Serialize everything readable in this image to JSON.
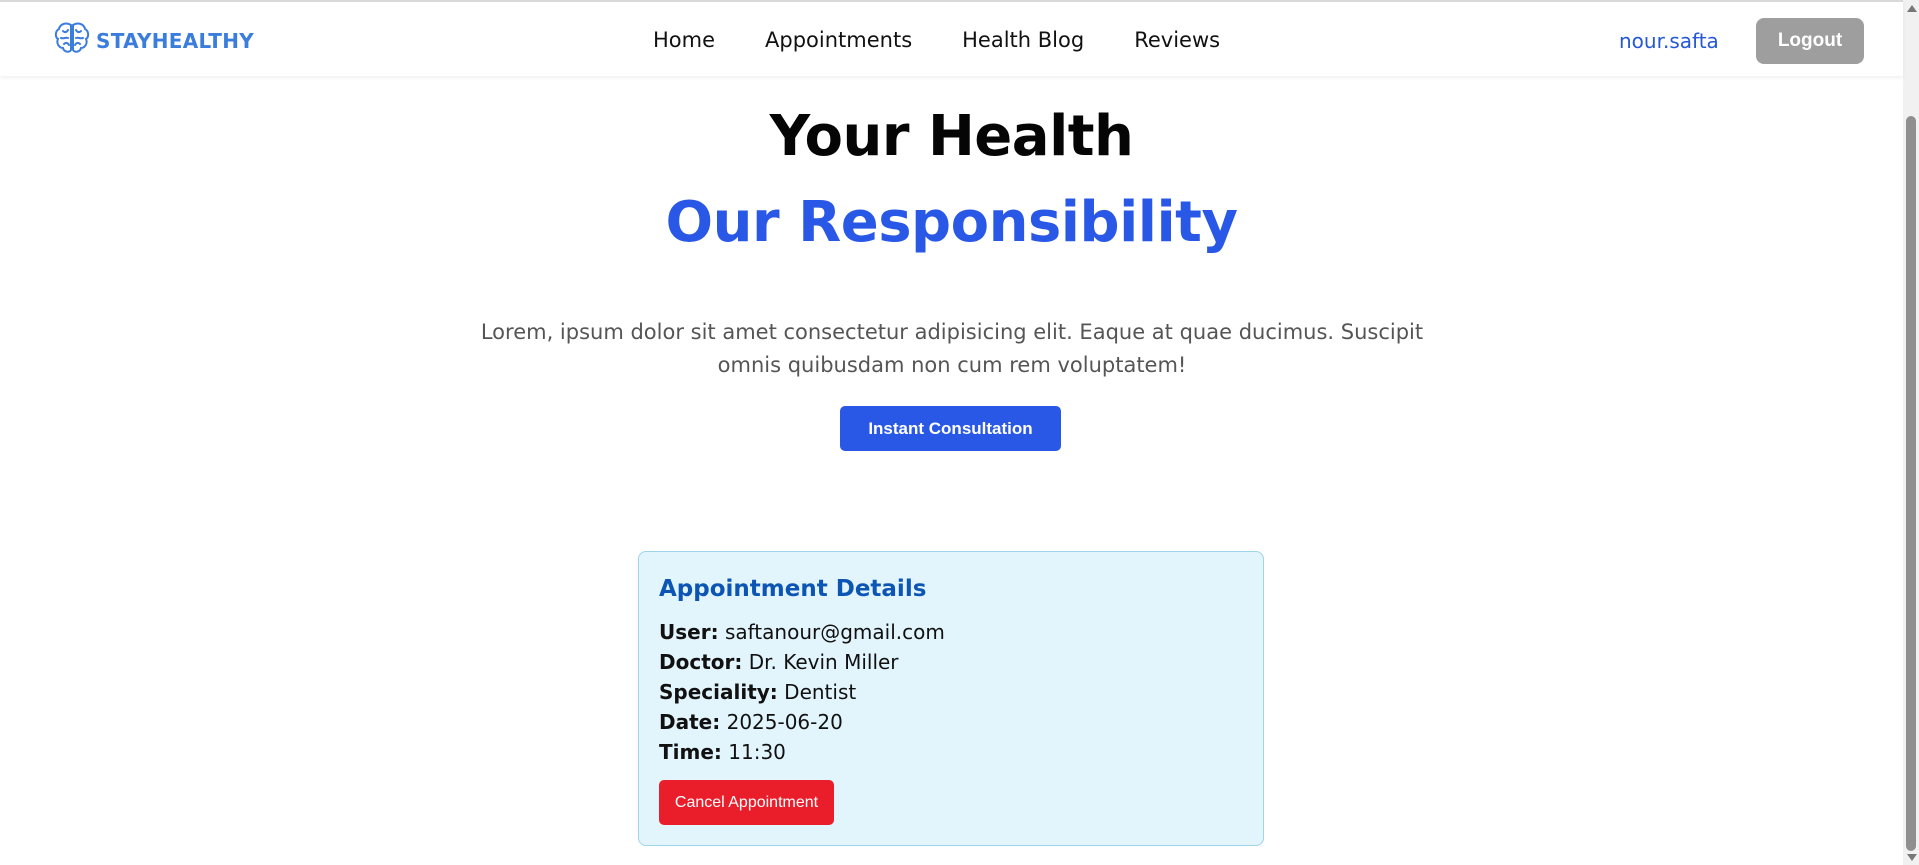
{
  "navbar": {
    "brand": "STAYHEALTHY",
    "links": [
      "Home",
      "Appointments",
      "Health Blog",
      "Reviews"
    ],
    "username": "nour.safta",
    "logout_label": "Logout"
  },
  "hero": {
    "title_line1": "Your Health",
    "title_line2": "Our Responsibility",
    "description": "Lorem, ipsum dolor sit amet consectetur adipisicing elit. Eaque at quae ducimus. Suscipit omnis quibusdam non cum rem voluptatem!",
    "cta_label": "Instant Consultation"
  },
  "appointment": {
    "title": "Appointment Details",
    "fields": [
      {
        "label": "User:",
        "value": "saftanour@gmail.com"
      },
      {
        "label": "Doctor:",
        "value": "Dr. Kevin Miller"
      },
      {
        "label": "Speciality:",
        "value": "Dentist"
      },
      {
        "label": "Date:",
        "value": "2025-06-20"
      },
      {
        "label": "Time:",
        "value": "11:30"
      }
    ],
    "cancel_label": "Cancel Appointment"
  },
  "icons": {
    "brand": "brain-icon"
  },
  "colors": {
    "brand": "#3b7ddd",
    "accent": "#2a58e6",
    "card_bg": "#e3f5fc",
    "card_title": "#0c55b4",
    "danger": "#ea1e2b",
    "logout_bg": "#9e9e9e"
  }
}
